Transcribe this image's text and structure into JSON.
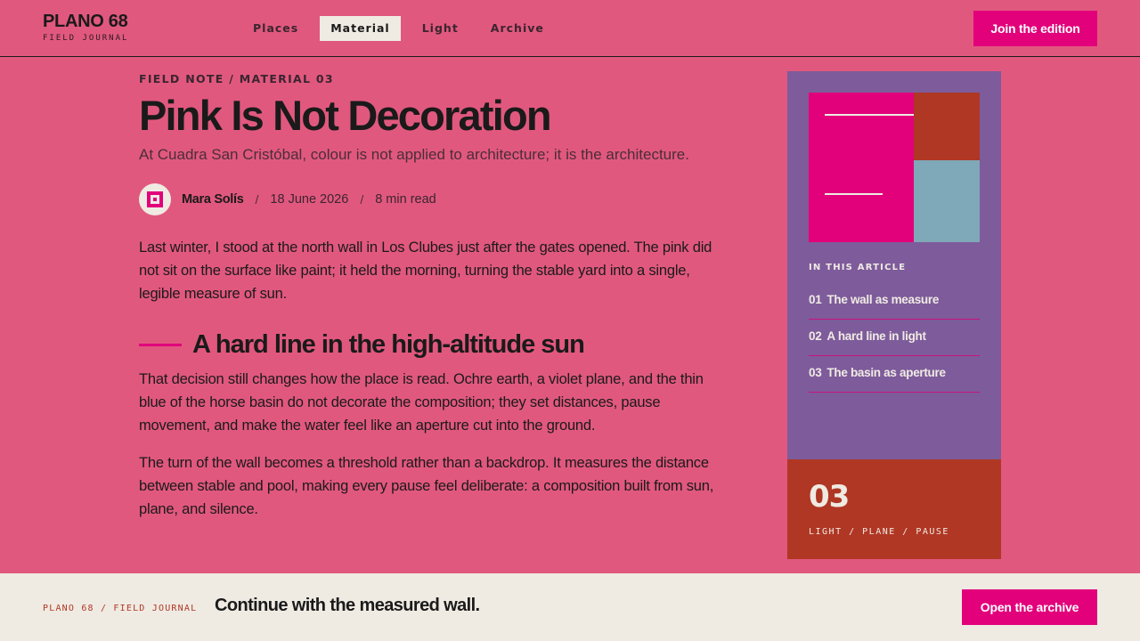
{
  "header": {
    "brand": "PLANO 68",
    "brand_sub": "FIELD JOURNAL",
    "nav": [
      "Places",
      "Material",
      "Light",
      "Archive"
    ],
    "nav_active": "Material",
    "cta": "Join the edition"
  },
  "article": {
    "kicker": "FIELD NOTE / MATERIAL 03",
    "title": "Pink Is Not Decoration",
    "subtitle": "At Cuadra San Cristóbal, colour is not applied to architecture; it is the architecture.",
    "author": "Mara Solís",
    "separator": "/",
    "date": "18 June 2026",
    "read_time": "8 min read",
    "paragraphs": [
      "Last winter, I stood at the north wall in Los Clubes just after the gates opened. The pink did not sit on the surface like paint; it held the morning, turning the stable yard into a single, legible measure of sun.",
      "That decision still changes how the place is read. Ochre earth, a violet plane, and the thin blue of the horse basin do not decorate the composition; they set distances, pause movement, and make the water feel like an aperture cut into the ground.",
      "The turn of the wall becomes a threshold rather than a backdrop. It measures the distance between stable and pool, making every pause feel deliberate: a composition built from sun, plane, and silence."
    ],
    "section_title": "A hard line in the high-altitude sun"
  },
  "sidebar": {
    "toc_heading": "IN THIS ARTICLE",
    "toc": [
      {
        "num": "01",
        "label": "The wall as measure"
      },
      {
        "num": "02",
        "label": "A hard line in light"
      },
      {
        "num": "03",
        "label": "The basin as aperture"
      }
    ],
    "big_number": "03",
    "tags": "LIGHT / PLANE / PAUSE"
  },
  "footer": {
    "label": "PLANO 68 / FIELD JOURNAL",
    "line": "Continue with the measured wall.",
    "cta": "Open the archive"
  },
  "colors": {
    "background": "#e1587e",
    "accent": "#e2007b",
    "violet": "#7e5b9b",
    "rust": "#b03724",
    "basin_blue": "#7fa8b8",
    "paper": "#efebe3",
    "ink": "#1a1a1a"
  }
}
